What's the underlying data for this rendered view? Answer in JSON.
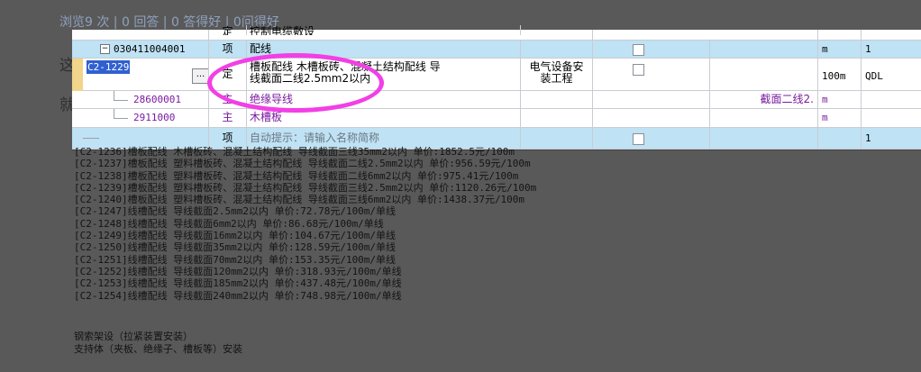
{
  "header": {
    "stats": "浏览9 次 | 0 回答 | 0 答得好 | 0问得好"
  },
  "bg_labels": [
    "这",
    "就"
  ],
  "grid": {
    "top_row": {
      "type": "定",
      "name": "控制电缆敷设"
    },
    "rows": [
      {
        "code": "030411004001",
        "type": "项",
        "name": "配线",
        "unit": "m",
        "qty": "1",
        "style": "blue",
        "checkbox": true,
        "expander": "−"
      },
      {
        "code": "C2-1229",
        "type": "定",
        "name_line1": "槽板配线 木槽板砖、混凝土结构配线 导",
        "name_line2": "线截面二线2.5mm2以内",
        "discipline_line1": "电气设备安",
        "discipline_line2": "装工程",
        "unit": "100m",
        "qty": "QDL",
        "style": "white",
        "checkbox": true,
        "ellipsis": "..."
      },
      {
        "code": "28600001",
        "type": "主",
        "name": "绝缘导线",
        "spec": "截面二线2.",
        "unit": "m",
        "style": "white"
      },
      {
        "code": "2911000",
        "type": "主",
        "name": "木槽板",
        "unit": "m",
        "style": "white"
      },
      {
        "code": "",
        "type": "项",
        "name": "自动提示：请输入名称简称",
        "qty": "1",
        "style": "blue",
        "checkbox": true
      }
    ]
  },
  "dropdown_items": [
    "[C2-1236]槽板配线 木槽板砖、混凝土结构配线 导线截面三线35mm2以内 单价:1852.5元/100m",
    "[C2-1237]槽板配线 塑料槽板砖、混凝土结构配线 导线截面二线2.5mm2以内 单价:956.59元/100m",
    "[C2-1238]槽板配线 塑料槽板砖、混凝土结构配线 导线截面二线6mm2以内 单价:975.41元/100m",
    "[C2-1239]槽板配线 塑料槽板砖、混凝土结构配线 导线截面三线2.5mm2以内 单价:1120.26元/100m",
    "[C2-1240]槽板配线 塑料槽板砖、混凝土结构配线 导线截面三线6mm2以内 单价:1438.37元/100m",
    "[C2-1247]线槽配线 导线截面2.5mm2以内 单价:72.78元/100m/单线",
    "[C2-1248]线槽配线 导线截面6mm2以内 单价:86.68元/100m/单线",
    "[C2-1249]线槽配线 导线截面16mm2以内 单价:104.67元/100m/单线",
    "[C2-1250]线槽配线 导线截面35mm2以内 单价:128.59元/100m/单线",
    "[C2-1251]线槽配线 导线截面70mm2以内 单价:153.35元/100m/单线",
    "[C2-1252]线槽配线 导线截面120mm2以内 单价:318.93元/100m/单线",
    "[C2-1253]线槽配线 导线截面185mm2以内 单价:437.48元/100m/单线",
    "[C2-1254]线槽配线 导线截面240mm2以内 单价:748.98元/100m/单线"
  ],
  "tail_lines": [
    "钢索架设（拉紧装置安装）",
    "支持体（夹板、绝缘子、槽板等）安装"
  ],
  "colors": {
    "row_blue": "#bfe2f4",
    "highlight": "#f23fe6",
    "purple_text": "#7a1aa0"
  }
}
